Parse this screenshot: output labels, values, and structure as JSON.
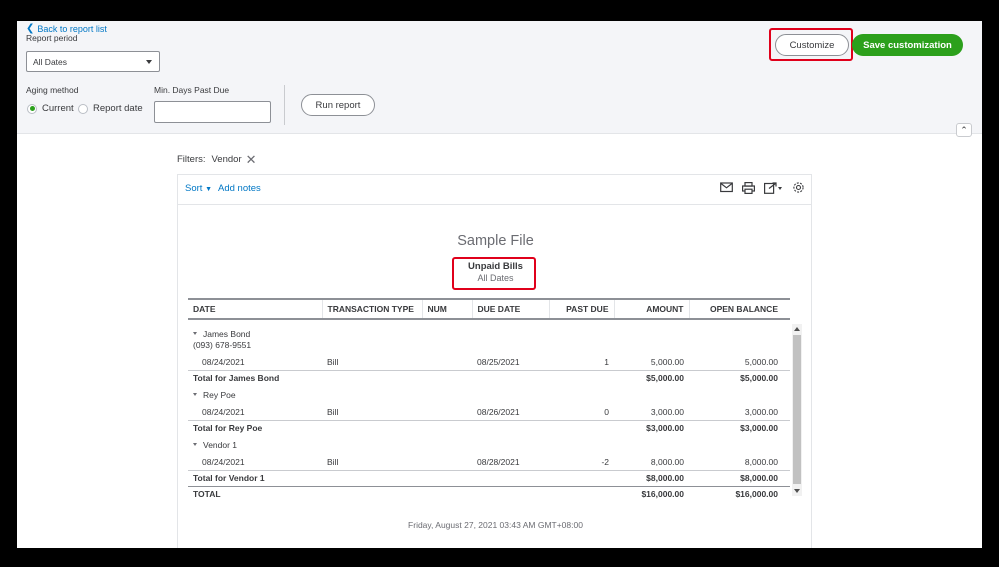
{
  "header": {
    "back_label": "Back to report list",
    "report_period_label": "Report period",
    "report_period_value": "All Dates",
    "aging_method_label": "Aging method",
    "aging_current_label": "Current",
    "aging_report_date_label": "Report date",
    "min_days_label": "Min. Days Past Due",
    "min_days_value": "",
    "run_report_label": "Run report",
    "customize_label": "Customize",
    "save_customization_label": "Save customization"
  },
  "filters": {
    "label": "Filters:",
    "chip": "Vendor"
  },
  "report_toolbar": {
    "sort_label": "Sort",
    "add_notes_label": "Add notes"
  },
  "report": {
    "company": "Sample File",
    "title": "Unpaid Bills",
    "subtitle": "All Dates",
    "columns": [
      "DATE",
      "TRANSACTION TYPE",
      "NUM",
      "DUE DATE",
      "PAST DUE",
      "AMOUNT",
      "OPEN BALANCE"
    ],
    "vendors": [
      {
        "name": "James Bond",
        "phone": "(093) 678-9551",
        "row": {
          "date": "08/24/2021",
          "type": "Bill",
          "num": "",
          "due": "08/25/2021",
          "past_due": "1",
          "amount": "5,000.00",
          "balance": "5,000.00"
        },
        "total_label": "Total for James Bond",
        "total_amount": "$5,000.00",
        "total_balance": "$5,000.00"
      },
      {
        "name": "Rey Poe",
        "row": {
          "date": "08/24/2021",
          "type": "Bill",
          "num": "",
          "due": "08/26/2021",
          "past_due": "0",
          "amount": "3,000.00",
          "balance": "3,000.00"
        },
        "total_label": "Total for Rey Poe",
        "total_amount": "$3,000.00",
        "total_balance": "$3,000.00"
      },
      {
        "name": "Vendor 1",
        "row": {
          "date": "08/24/2021",
          "type": "Bill",
          "num": "",
          "due": "08/28/2021",
          "past_due": "-2",
          "amount": "8,000.00",
          "balance": "8,000.00"
        },
        "total_label": "Total for Vendor 1",
        "total_amount": "$8,000.00",
        "total_balance": "$8,000.00"
      }
    ],
    "grand_total_label": "TOTAL",
    "grand_total_amount": "$16,000.00",
    "grand_total_balance": "$16,000.00",
    "footer": "Friday, August 27, 2021   03:43 AM GMT+08:00"
  },
  "colors": {
    "accent_green": "#2ca01c",
    "link_blue": "#0077c5",
    "highlight_red": "#e0001b"
  },
  "icons": [
    "back-chevron-icon",
    "dropdown-arrow-icon",
    "close-icon",
    "email-icon",
    "print-icon",
    "export-icon",
    "gear-icon",
    "collapse-chevron-icon"
  ]
}
